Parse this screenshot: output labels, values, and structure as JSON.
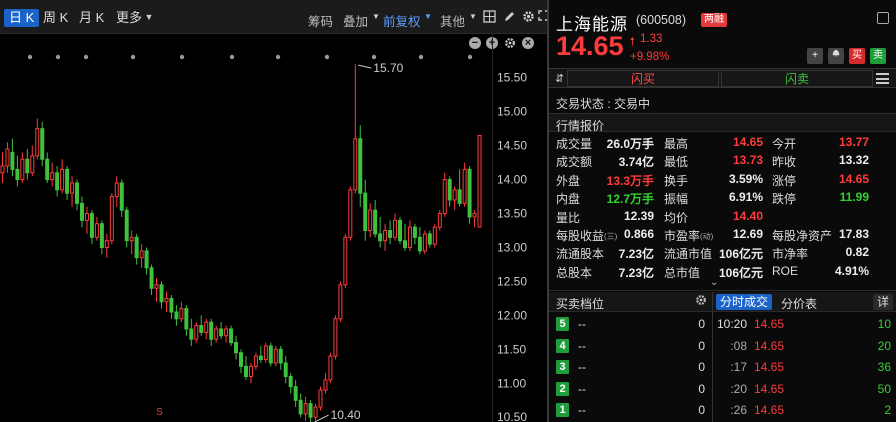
{
  "chart_toolbar": {
    "period_tabs": [
      "日 K",
      "周 K",
      "月 K",
      "更多"
    ],
    "tools": [
      "筹码",
      "叠加",
      "前复权",
      "其他"
    ]
  },
  "chart_data": {
    "type": "candlestick",
    "y_ticks": [
      "15.50",
      "15.00",
      "14.50",
      "14.00",
      "13.50",
      "13.00",
      "12.50",
      "12.00",
      "11.50",
      "11.00",
      "10.50"
    ],
    "ylim": [
      10.43,
      15.82
    ],
    "high_label": "15.70",
    "low_label": "10.40",
    "marker_label": "S",
    "up_color": "#ff3b3b",
    "down_color": "#3ec23e",
    "candles": [
      {
        "o": 14.1,
        "h": 14.4,
        "l": 13.95,
        "c": 14.2
      },
      {
        "o": 14.2,
        "h": 14.55,
        "l": 14.1,
        "c": 14.45
      },
      {
        "o": 14.4,
        "h": 14.6,
        "l": 14.05,
        "c": 14.15
      },
      {
        "o": 14.15,
        "h": 14.35,
        "l": 13.9,
        "c": 14.0
      },
      {
        "o": 14.0,
        "h": 14.4,
        "l": 13.95,
        "c": 14.3
      },
      {
        "o": 14.3,
        "h": 14.45,
        "l": 14.0,
        "c": 14.1
      },
      {
        "o": 14.1,
        "h": 14.5,
        "l": 14.05,
        "c": 14.35
      },
      {
        "o": 14.35,
        "h": 14.9,
        "l": 14.3,
        "c": 14.75
      },
      {
        "o": 14.75,
        "h": 14.85,
        "l": 14.2,
        "c": 14.3
      },
      {
        "o": 14.3,
        "h": 14.4,
        "l": 13.95,
        "c": 14.0
      },
      {
        "o": 14.0,
        "h": 14.25,
        "l": 13.9,
        "c": 14.1
      },
      {
        "o": 14.1,
        "h": 14.2,
        "l": 13.75,
        "c": 13.85
      },
      {
        "o": 13.85,
        "h": 14.3,
        "l": 13.8,
        "c": 14.15
      },
      {
        "o": 14.15,
        "h": 14.2,
        "l": 13.7,
        "c": 13.8
      },
      {
        "o": 13.8,
        "h": 14.05,
        "l": 13.6,
        "c": 13.95
      },
      {
        "o": 13.95,
        "h": 14.0,
        "l": 13.55,
        "c": 13.65
      },
      {
        "o": 13.65,
        "h": 13.75,
        "l": 13.3,
        "c": 13.4
      },
      {
        "o": 13.4,
        "h": 13.6,
        "l": 13.2,
        "c": 13.5
      },
      {
        "o": 13.5,
        "h": 13.55,
        "l": 13.05,
        "c": 13.15
      },
      {
        "o": 13.15,
        "h": 13.45,
        "l": 13.1,
        "c": 13.35
      },
      {
        "o": 13.35,
        "h": 13.4,
        "l": 12.9,
        "c": 13.0
      },
      {
        "o": 13.0,
        "h": 13.2,
        "l": 12.85,
        "c": 13.1
      },
      {
        "o": 13.1,
        "h": 13.8,
        "l": 13.05,
        "c": 13.75
      },
      {
        "o": 13.75,
        "h": 14.05,
        "l": 13.6,
        "c": 13.95
      },
      {
        "o": 13.95,
        "h": 14.0,
        "l": 13.45,
        "c": 13.55
      },
      {
        "o": 13.55,
        "h": 13.6,
        "l": 13.0,
        "c": 13.1
      },
      {
        "o": 13.1,
        "h": 13.25,
        "l": 12.9,
        "c": 13.15
      },
      {
        "o": 13.15,
        "h": 13.2,
        "l": 12.75,
        "c": 12.85
      },
      {
        "o": 12.85,
        "h": 13.05,
        "l": 12.7,
        "c": 12.95
      },
      {
        "o": 12.95,
        "h": 13.0,
        "l": 12.6,
        "c": 12.7
      },
      {
        "o": 12.7,
        "h": 12.75,
        "l": 12.3,
        "c": 12.4
      },
      {
        "o": 12.4,
        "h": 12.55,
        "l": 12.2,
        "c": 12.45
      },
      {
        "o": 12.45,
        "h": 12.5,
        "l": 12.1,
        "c": 12.2
      },
      {
        "o": 12.2,
        "h": 12.35,
        "l": 12.05,
        "c": 12.25
      },
      {
        "o": 12.25,
        "h": 12.3,
        "l": 11.95,
        "c": 12.05
      },
      {
        "o": 12.05,
        "h": 12.15,
        "l": 11.85,
        "c": 11.95
      },
      {
        "o": 11.95,
        "h": 12.2,
        "l": 11.9,
        "c": 12.1
      },
      {
        "o": 12.1,
        "h": 12.15,
        "l": 11.7,
        "c": 11.8
      },
      {
        "o": 11.8,
        "h": 11.95,
        "l": 11.55,
        "c": 11.65
      },
      {
        "o": 11.65,
        "h": 11.9,
        "l": 11.6,
        "c": 11.85
      },
      {
        "o": 11.85,
        "h": 12.0,
        "l": 11.7,
        "c": 11.75
      },
      {
        "o": 11.75,
        "h": 11.95,
        "l": 11.65,
        "c": 11.9
      },
      {
        "o": 11.9,
        "h": 11.95,
        "l": 11.55,
        "c": 11.65
      },
      {
        "o": 11.65,
        "h": 11.85,
        "l": 11.6,
        "c": 11.8
      },
      {
        "o": 11.8,
        "h": 11.9,
        "l": 11.65,
        "c": 11.7
      },
      {
        "o": 11.7,
        "h": 11.85,
        "l": 11.6,
        "c": 11.8
      },
      {
        "o": 11.8,
        "h": 11.85,
        "l": 11.55,
        "c": 11.6
      },
      {
        "o": 11.6,
        "h": 11.7,
        "l": 11.35,
        "c": 11.45
      },
      {
        "o": 11.45,
        "h": 11.5,
        "l": 11.15,
        "c": 11.25
      },
      {
        "o": 11.25,
        "h": 11.4,
        "l": 11.05,
        "c": 11.1
      },
      {
        "o": 11.1,
        "h": 11.3,
        "l": 11.0,
        "c": 11.25
      },
      {
        "o": 11.25,
        "h": 11.45,
        "l": 11.2,
        "c": 11.4
      },
      {
        "o": 11.4,
        "h": 11.55,
        "l": 11.3,
        "c": 11.35
      },
      {
        "o": 11.35,
        "h": 11.6,
        "l": 11.3,
        "c": 11.55
      },
      {
        "o": 11.55,
        "h": 11.6,
        "l": 11.25,
        "c": 11.3
      },
      {
        "o": 11.3,
        "h": 11.55,
        "l": 11.25,
        "c": 11.5
      },
      {
        "o": 11.5,
        "h": 11.55,
        "l": 11.2,
        "c": 11.3
      },
      {
        "o": 11.3,
        "h": 11.4,
        "l": 11.0,
        "c": 11.1
      },
      {
        "o": 11.1,
        "h": 11.15,
        "l": 10.85,
        "c": 10.95
      },
      {
        "o": 10.95,
        "h": 11.05,
        "l": 10.65,
        "c": 10.75
      },
      {
        "o": 10.75,
        "h": 10.85,
        "l": 10.5,
        "c": 10.55
      },
      {
        "o": 10.55,
        "h": 10.8,
        "l": 10.45,
        "c": 10.7
      },
      {
        "o": 10.7,
        "h": 10.75,
        "l": 10.4,
        "c": 10.5
      },
      {
        "o": 10.5,
        "h": 10.7,
        "l": 10.45,
        "c": 10.65
      },
      {
        "o": 10.65,
        "h": 10.95,
        "l": 10.6,
        "c": 10.9
      },
      {
        "o": 10.9,
        "h": 11.15,
        "l": 10.85,
        "c": 11.05
      },
      {
        "o": 11.05,
        "h": 11.45,
        "l": 11.0,
        "c": 11.4
      },
      {
        "o": 11.4,
        "h": 12.0,
        "l": 11.35,
        "c": 11.95
      },
      {
        "o": 11.95,
        "h": 12.5,
        "l": 11.9,
        "c": 12.45
      },
      {
        "o": 12.45,
        "h": 13.2,
        "l": 12.4,
        "c": 13.15
      },
      {
        "o": 13.15,
        "h": 13.9,
        "l": 13.1,
        "c": 13.85
      },
      {
        "o": 13.85,
        "h": 15.7,
        "l": 13.8,
        "c": 14.6
      },
      {
        "o": 14.6,
        "h": 14.8,
        "l": 13.6,
        "c": 13.8
      },
      {
        "o": 13.8,
        "h": 14.0,
        "l": 13.1,
        "c": 13.25
      },
      {
        "o": 13.25,
        "h": 13.65,
        "l": 13.15,
        "c": 13.55
      },
      {
        "o": 13.55,
        "h": 13.7,
        "l": 13.15,
        "c": 13.2
      },
      {
        "o": 13.2,
        "h": 13.45,
        "l": 13.0,
        "c": 13.1
      },
      {
        "o": 13.1,
        "h": 13.35,
        "l": 12.95,
        "c": 13.25
      },
      {
        "o": 13.25,
        "h": 13.4,
        "l": 13.05,
        "c": 13.15
      },
      {
        "o": 13.15,
        "h": 13.5,
        "l": 13.1,
        "c": 13.4
      },
      {
        "o": 13.4,
        "h": 13.45,
        "l": 13.05,
        "c": 13.1
      },
      {
        "o": 13.1,
        "h": 13.35,
        "l": 12.95,
        "c": 13.0
      },
      {
        "o": 13.0,
        "h": 13.4,
        "l": 12.95,
        "c": 13.3
      },
      {
        "o": 13.3,
        "h": 13.35,
        "l": 13.05,
        "c": 13.15
      },
      {
        "o": 13.15,
        "h": 13.3,
        "l": 12.9,
        "c": 12.95
      },
      {
        "o": 12.95,
        "h": 13.25,
        "l": 12.9,
        "c": 13.2
      },
      {
        "o": 13.2,
        "h": 13.25,
        "l": 13.0,
        "c": 13.05
      },
      {
        "o": 13.05,
        "h": 13.35,
        "l": 13.0,
        "c": 13.3
      },
      {
        "o": 13.3,
        "h": 13.55,
        "l": 13.25,
        "c": 13.5
      },
      {
        "o": 13.5,
        "h": 14.1,
        "l": 13.45,
        "c": 14.0
      },
      {
        "o": 14.0,
        "h": 14.05,
        "l": 13.6,
        "c": 13.7
      },
      {
        "o": 13.7,
        "h": 13.9,
        "l": 13.55,
        "c": 13.85
      },
      {
        "o": 13.85,
        "h": 14.15,
        "l": 13.6,
        "c": 13.65
      },
      {
        "o": 13.65,
        "h": 14.25,
        "l": 13.6,
        "c": 14.15
      },
      {
        "o": 14.15,
        "h": 14.2,
        "l": 13.35,
        "c": 13.45
      },
      {
        "o": 13.45,
        "h": 13.55,
        "l": 13.3,
        "c": 13.5
      },
      {
        "o": 13.3,
        "h": 14.65,
        "l": 13.3,
        "c": 14.65
      }
    ]
  },
  "stock": {
    "name": "上海能源",
    "code": "(600508)",
    "badge": "两融",
    "price": "14.65",
    "change": "1.33",
    "pct": "+9.98%",
    "actions": [
      "+",
      "🔔",
      "买",
      "卖"
    ]
  },
  "flash": {
    "buy": "闪买",
    "sell": "闪卖"
  },
  "status_text": "交易状态 : 交易中",
  "quote_title": "行情报价",
  "quote_rows": [
    [
      {
        "l": "成交量",
        "v": "26.0万手",
        "c": "white"
      },
      {
        "l": "最高",
        "v": "14.65",
        "c": "red"
      },
      {
        "l": "今开",
        "v": "13.77",
        "c": "red"
      }
    ],
    [
      {
        "l": "成交额",
        "v": "3.74亿",
        "c": "white"
      },
      {
        "l": "最低",
        "v": "13.73",
        "c": "red"
      },
      {
        "l": "昨收",
        "v": "13.32",
        "c": "white"
      }
    ],
    [
      {
        "l": "外盘",
        "v": "13.3万手",
        "c": "red"
      },
      {
        "l": "换手",
        "v": "3.59%",
        "c": "white"
      },
      {
        "l": "涨停",
        "v": "14.65",
        "c": "red"
      }
    ],
    [
      {
        "l": "内盘",
        "v": "12.7万手",
        "c": "green"
      },
      {
        "l": "振幅",
        "v": "6.91%",
        "c": "white"
      },
      {
        "l": "跌停",
        "v": "11.99",
        "c": "green"
      }
    ],
    [
      {
        "l": "量比",
        "v": "12.39",
        "c": "white"
      },
      {
        "l": "均价",
        "v": "14.40",
        "c": "red"
      }
    ]
  ],
  "fin_rows": [
    [
      {
        "l": "每股收益",
        "sup": "(三)",
        "v": "0.866"
      },
      {
        "l": "市盈率",
        "sup": "(动)",
        "v": "12.69"
      },
      {
        "l": "每股净资产",
        "v": "17.83"
      }
    ],
    [
      {
        "l": "流通股本",
        "v": "7.23亿"
      },
      {
        "l": "流通市值",
        "v": "106亿元"
      },
      {
        "l": "市净率",
        "v": "0.82"
      }
    ],
    [
      {
        "l": "总股本",
        "v": "7.23亿"
      },
      {
        "l": "总市值",
        "v": "106亿元"
      },
      {
        "l": "ROE",
        "v": "4.91%"
      }
    ]
  ],
  "orderbook": {
    "title": "买卖档位",
    "rows": [
      {
        "n": "5",
        "p": "--",
        "v": "0"
      },
      {
        "n": "4",
        "p": "--",
        "v": "0"
      },
      {
        "n": "3",
        "p": "--",
        "v": "0"
      },
      {
        "n": "2",
        "p": "--",
        "v": "0"
      },
      {
        "n": "1",
        "p": "--",
        "v": "0"
      }
    ]
  },
  "ticks": {
    "tab_active": "分时成交",
    "tab_other": "分价表",
    "detail": "详",
    "rows": [
      {
        "t": "10:20",
        "p": "14.65",
        "v": "10"
      },
      {
        "t": ":08",
        "p": "14.65",
        "v": "20"
      },
      {
        "t": ":17",
        "p": "14.65",
        "v": "36"
      },
      {
        "t": ":20",
        "p": "14.65",
        "v": "50"
      },
      {
        "t": ":26",
        "p": "14.65",
        "v": "2"
      }
    ]
  }
}
